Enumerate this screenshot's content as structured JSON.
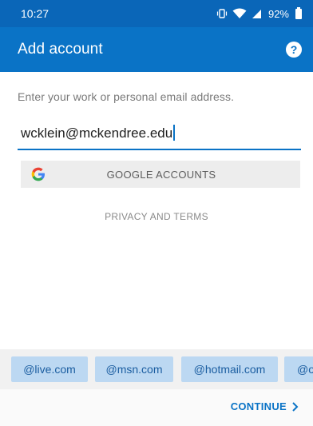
{
  "status_bar": {
    "time": "10:27",
    "battery_pct": "92%",
    "icons": [
      "vibrate-icon",
      "wifi-icon",
      "signal-icon",
      "battery-icon"
    ]
  },
  "app_bar": {
    "title": "Add account",
    "help_label": "?"
  },
  "form": {
    "instruction": "Enter your work or personal email address.",
    "email_value": "wcklein@mckendree.edu"
  },
  "google_button": {
    "label": "GOOGLE ACCOUNTS",
    "icon": "google-logo-icon"
  },
  "privacy_link": "PRIVACY AND TERMS",
  "suggestions": [
    "@live.com",
    "@msn.com",
    "@hotmail.com",
    "@o"
  ],
  "continue_label": "CONTINUE",
  "colors": {
    "status_bar": "#0a66b8",
    "app_bar": "#0a73c6",
    "chip_bg": "#bcd8f2",
    "chip_text": "#1a5da0",
    "accent": "#0a73c6"
  }
}
